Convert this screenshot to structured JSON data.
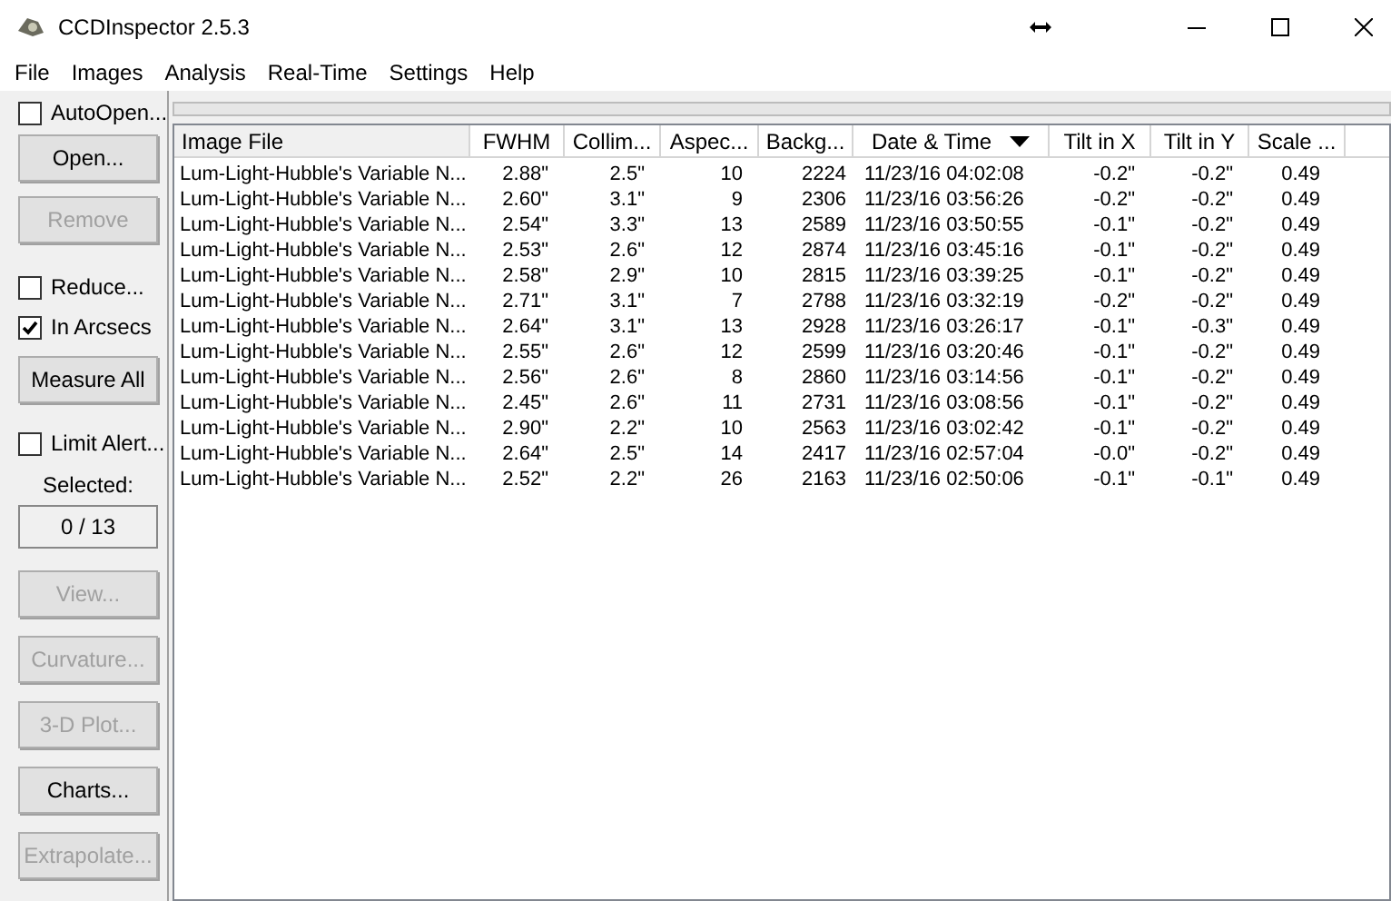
{
  "window": {
    "title": "CCDInspector 2.5.3"
  },
  "progress": {
    "level": 0
  },
  "menu": [
    "File",
    "Images",
    "Analysis",
    "Real-Time",
    "Settings",
    "Help"
  ],
  "sidebar": [
    {
      "kind": "checkbox",
      "label": "AutoOpen...",
      "checked": false
    },
    {
      "kind": "button",
      "label": "Open...",
      "disabled": false
    },
    {
      "kind": "button",
      "label": "Remove",
      "disabled": true
    },
    {
      "kind": "checkbox",
      "label": "Reduce...",
      "checked": false
    },
    {
      "kind": "checkbox",
      "label": "In Arcsecs",
      "checked": true
    },
    {
      "kind": "button",
      "label": "Measure All",
      "disabled": false
    },
    {
      "kind": "checkbox",
      "label": "Limit Alert...",
      "checked": false
    },
    {
      "kind": "label",
      "label": "Selected:"
    },
    {
      "kind": "readout",
      "label": "0 / 13"
    },
    {
      "kind": "button",
      "label": "View...",
      "disabled": true
    },
    {
      "kind": "button",
      "label": "Curvature...",
      "disabled": true
    },
    {
      "kind": "button",
      "label": "3-D Plot...",
      "disabled": true
    },
    {
      "kind": "button",
      "label": "Charts...",
      "disabled": false
    },
    {
      "kind": "button",
      "label": "Extrapolate...",
      "disabled": true
    }
  ],
  "table": {
    "columns": [
      {
        "label": "Image File",
        "sorted": false
      },
      {
        "label": "FWHM",
        "sorted": false
      },
      {
        "label": "Collim...",
        "sorted": false
      },
      {
        "label": "Aspec...",
        "sorted": false
      },
      {
        "label": "Backg...",
        "sorted": false
      },
      {
        "label": "Date & Time",
        "sorted": true
      },
      {
        "label": "Tilt in X",
        "sorted": false
      },
      {
        "label": "Tilt in Y",
        "sorted": false
      },
      {
        "label": "Scale ...",
        "sorted": false
      }
    ],
    "rows": [
      [
        "Lum-Light-Hubble's Variable N...",
        "2.88\"",
        "2.5\"",
        "10",
        "2224",
        "11/23/16 04:02:08",
        "-0.2\"",
        "-0.2\"",
        "0.49"
      ],
      [
        "Lum-Light-Hubble's Variable N...",
        "2.60\"",
        "3.1\"",
        "9",
        "2306",
        "11/23/16 03:56:26",
        "-0.2\"",
        "-0.2\"",
        "0.49"
      ],
      [
        "Lum-Light-Hubble's Variable N...",
        "2.54\"",
        "3.3\"",
        "13",
        "2589",
        "11/23/16 03:50:55",
        "-0.1\"",
        "-0.2\"",
        "0.49"
      ],
      [
        "Lum-Light-Hubble's Variable N...",
        "2.53\"",
        "2.6\"",
        "12",
        "2874",
        "11/23/16 03:45:16",
        "-0.1\"",
        "-0.2\"",
        "0.49"
      ],
      [
        "Lum-Light-Hubble's Variable N...",
        "2.58\"",
        "2.9\"",
        "10",
        "2815",
        "11/23/16 03:39:25",
        "-0.1\"",
        "-0.2\"",
        "0.49"
      ],
      [
        "Lum-Light-Hubble's Variable N...",
        "2.71\"",
        "3.1\"",
        "7",
        "2788",
        "11/23/16 03:32:19",
        "-0.2\"",
        "-0.2\"",
        "0.49"
      ],
      [
        "Lum-Light-Hubble's Variable N...",
        "2.64\"",
        "3.1\"",
        "13",
        "2928",
        "11/23/16 03:26:17",
        "-0.1\"",
        "-0.3\"",
        "0.49"
      ],
      [
        "Lum-Light-Hubble's Variable N...",
        "2.55\"",
        "2.6\"",
        "12",
        "2599",
        "11/23/16 03:20:46",
        "-0.1\"",
        "-0.2\"",
        "0.49"
      ],
      [
        "Lum-Light-Hubble's Variable N...",
        "2.56\"",
        "2.6\"",
        "8",
        "2860",
        "11/23/16 03:14:56",
        "-0.1\"",
        "-0.2\"",
        "0.49"
      ],
      [
        "Lum-Light-Hubble's Variable N...",
        "2.45\"",
        "2.6\"",
        "11",
        "2731",
        "11/23/16 03:08:56",
        "-0.1\"",
        "-0.2\"",
        "0.49"
      ],
      [
        "Lum-Light-Hubble's Variable N...",
        "2.90\"",
        "2.2\"",
        "10",
        "2563",
        "11/23/16 03:02:42",
        "-0.1\"",
        "-0.2\"",
        "0.49"
      ],
      [
        "Lum-Light-Hubble's Variable N...",
        "2.64\"",
        "2.5\"",
        "14",
        "2417",
        "11/23/16 02:57:04",
        "-0.0\"",
        "-0.2\"",
        "0.49"
      ],
      [
        "Lum-Light-Hubble's Variable N...",
        "2.52\"",
        "2.2\"",
        "26",
        "2163",
        "11/23/16 02:50:06",
        "-0.1\"",
        "-0.1\"",
        "0.49"
      ]
    ]
  }
}
